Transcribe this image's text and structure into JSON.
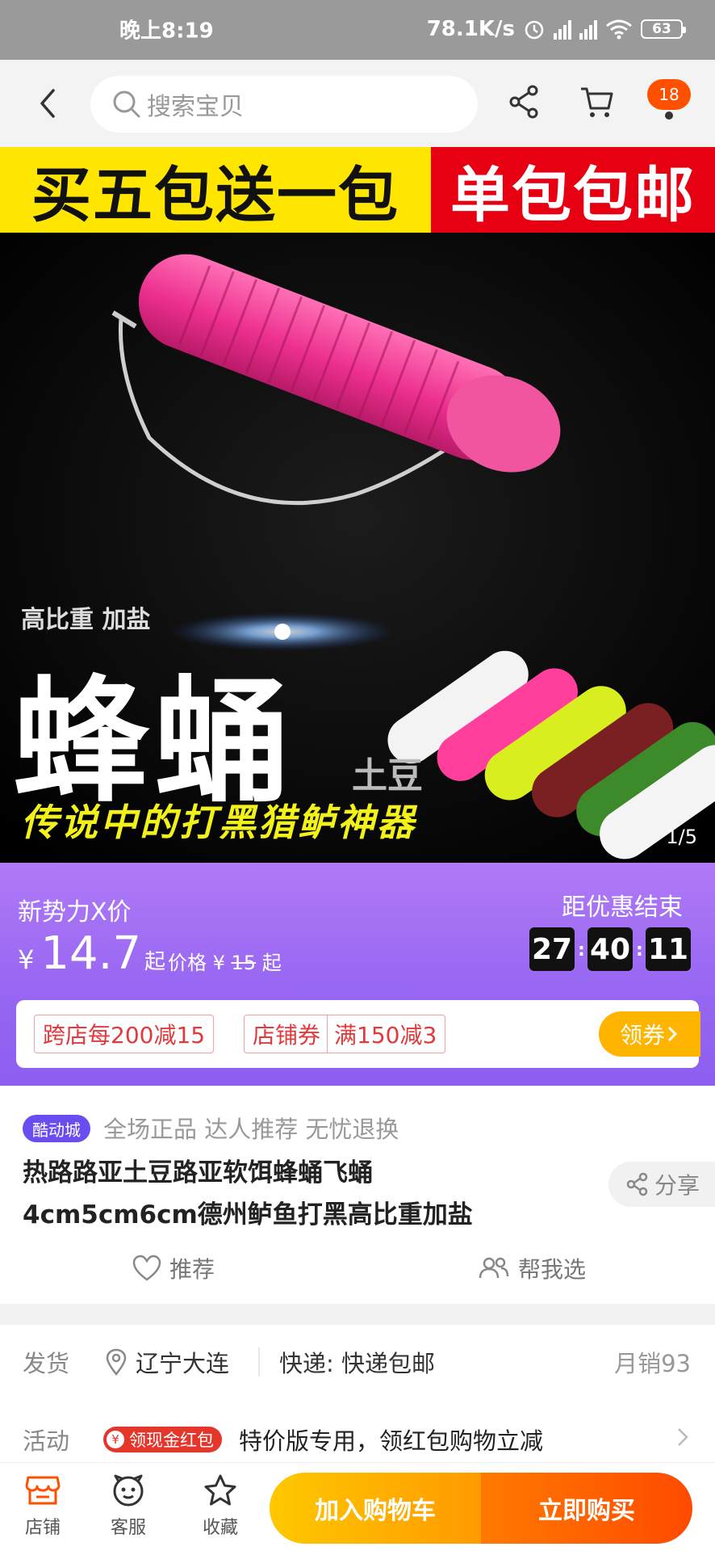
{
  "status_bar": {
    "time": "晚上8:19",
    "net_speed": "78.1K/s",
    "battery": "63"
  },
  "nav": {
    "search_placeholder": "搜索宝贝",
    "cart_badge": "18"
  },
  "hero": {
    "banner_left": "买五包送一包",
    "banner_right": "单包包邮",
    "tagline": "高比重 加盐",
    "big_title": "蜂蛹",
    "brand_small": "土豆",
    "slogan": "传说中的打黑猎鲈神器",
    "counter": "1/5"
  },
  "promo": {
    "label": "新势力X价",
    "currency": "¥",
    "price": "14.7",
    "price_suffix": "起",
    "orig_prefix": "价格 ¥",
    "orig_price": "15",
    "orig_suffix": "起",
    "ends_label": "距优惠结束",
    "countdown": [
      "27",
      "40",
      "11"
    ],
    "coupon_1": "跨店每200减15",
    "coupon_2_label": "店铺券",
    "coupon_2_value": "满150减3",
    "get_coupon": "领券"
  },
  "product": {
    "badge": "酷动城",
    "features": "全场正品 达人推荐 无忧退换",
    "title": "热路路亚土豆路亚软饵蜂蛹飞蛹4cm5cm6cm德州鲈鱼打黑高比重加盐",
    "share": "分享",
    "recommend": "推荐",
    "help_choose": "帮我选"
  },
  "shipping": {
    "ship_label": "发货",
    "location": "辽宁大连",
    "express": "快递: 快递包邮",
    "monthly_sales": "月销93",
    "activity_label": "活动",
    "red_packet": "领现金红包",
    "activity_desc": "特价版专用，领红包购物立减"
  },
  "bottom": {
    "shop": "店铺",
    "service": "客服",
    "favorite": "收藏",
    "add_cart": "加入购物车",
    "buy_now": "立即购买"
  },
  "colors": {
    "accent": "#ff5000",
    "promo_purple": "#9867f2",
    "coupon_red": "#e4393c",
    "cart_yellow": "#ffc800",
    "buy_orange": "#ff4a00"
  }
}
